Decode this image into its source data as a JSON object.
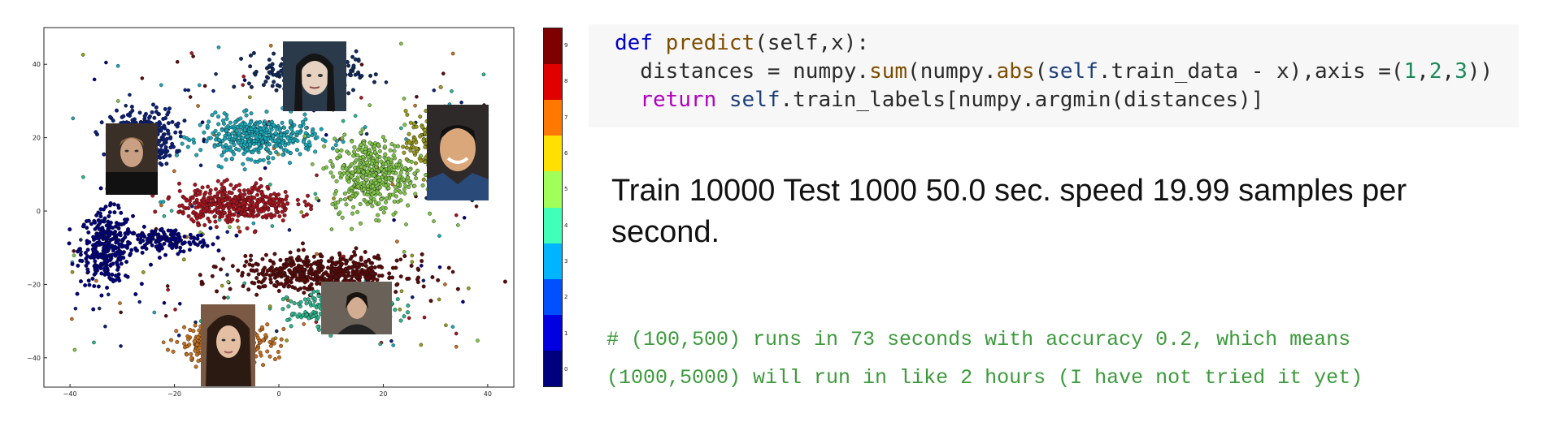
{
  "chart_data": {
    "type": "scatter",
    "title": "",
    "xlabel": "",
    "ylabel": "",
    "xlim": [
      -45,
      45
    ],
    "ylim": [
      -48,
      50
    ],
    "xticks": [
      -40,
      -20,
      0,
      20,
      40
    ],
    "yticks": [
      40,
      20,
      0,
      -20,
      -40
    ],
    "grid": false,
    "colorbar": {
      "range": [
        0,
        9
      ],
      "ticks": [
        "0",
        "1",
        "2",
        "3",
        "4",
        "5",
        "6",
        "7",
        "8",
        "9"
      ],
      "colors": [
        "#00007f",
        "#0000e0",
        "#0050ff",
        "#00b4ff",
        "#40ffb8",
        "#a0ff58",
        "#ffe000",
        "#ff7800",
        "#e00000",
        "#7f0000"
      ]
    },
    "series": [
      {
        "label_value": 0,
        "color": "#00007f",
        "clusters": [
          {
            "x": -33,
            "y": -10,
            "sx": 4.5,
            "sy": 9,
            "n": 320
          },
          {
            "x": -22,
            "y": -8,
            "sx": 8,
            "sy": 3,
            "n": 160
          }
        ]
      },
      {
        "label_value": 1,
        "color": "#0a1f7a",
        "clusters": [
          {
            "x": -26,
            "y": 20,
            "sx": 5.5,
            "sy": 7,
            "n": 320
          }
        ]
      },
      {
        "label_value": 2,
        "color": "#1aa7b8",
        "clusters": [
          {
            "x": -4,
            "y": 20,
            "sx": 10,
            "sy": 5,
            "n": 420
          }
        ]
      },
      {
        "label_value": 3,
        "color": "#0f2a5a",
        "clusters": [
          {
            "x": 6,
            "y": 38,
            "sx": 8,
            "sy": 5,
            "n": 320
          }
        ]
      },
      {
        "label_value": 4,
        "color": "#7fc447",
        "clusters": [
          {
            "x": 18,
            "y": 10,
            "sx": 7,
            "sy": 9,
            "n": 420
          }
        ]
      },
      {
        "label_value": 5,
        "color": "#9a9a1a",
        "clusters": [
          {
            "x": 30,
            "y": 18,
            "sx": 5,
            "sy": 8,
            "n": 260
          }
        ]
      },
      {
        "label_value": 6,
        "color": "#a8141e",
        "clusters": [
          {
            "x": -8,
            "y": 2,
            "sx": 10,
            "sy": 4.5,
            "n": 420
          }
        ]
      },
      {
        "label_value": 7,
        "color": "#5a0a0a",
        "clusters": [
          {
            "x": 8,
            "y": -17,
            "sx": 15,
            "sy": 4.5,
            "n": 520
          }
        ]
      },
      {
        "label_value": 8,
        "color": "#2bb58c",
        "clusters": [
          {
            "x": 12,
            "y": -27,
            "sx": 9,
            "sy": 4.5,
            "n": 260
          }
        ]
      },
      {
        "label_value": 9,
        "color": "#c4701e",
        "clusters": [
          {
            "x": -10,
            "y": -36,
            "sx": 8,
            "sy": 5,
            "n": 360
          }
        ]
      }
    ]
  },
  "faces": [
    {
      "name": "face-top"
    },
    {
      "name": "face-left"
    },
    {
      "name": "face-right"
    },
    {
      "name": "face-bottom-left"
    },
    {
      "name": "face-bottom-mid"
    }
  ],
  "code": {
    "line1": {
      "kw": "def",
      "fn": "predict",
      "rest": "(self,x):"
    },
    "line2": {
      "a": "  distances = numpy.",
      "fn": "sum",
      "b": "(numpy.",
      "fn2": "abs",
      "c": "(",
      "self": "self",
      "d": ".train_data - x),axis =(",
      "n1": "1",
      "e": ",",
      "n2": "2",
      "f": ",",
      "n3": "3",
      "g": "))"
    },
    "line3": {
      "ret": "  return",
      "self": " self",
      "rest": ".train_labels[numpy.argmin(distances)]"
    }
  },
  "statement": "Train 10000 Test 1000  50.0 sec. speed 19.99 samples per second.",
  "comments": [
    "# (100,500) runs in 73 seconds with accuracy 0.2, which means",
    "(1000,5000) will run in like 2 hours (I have not tried it yet)"
  ]
}
